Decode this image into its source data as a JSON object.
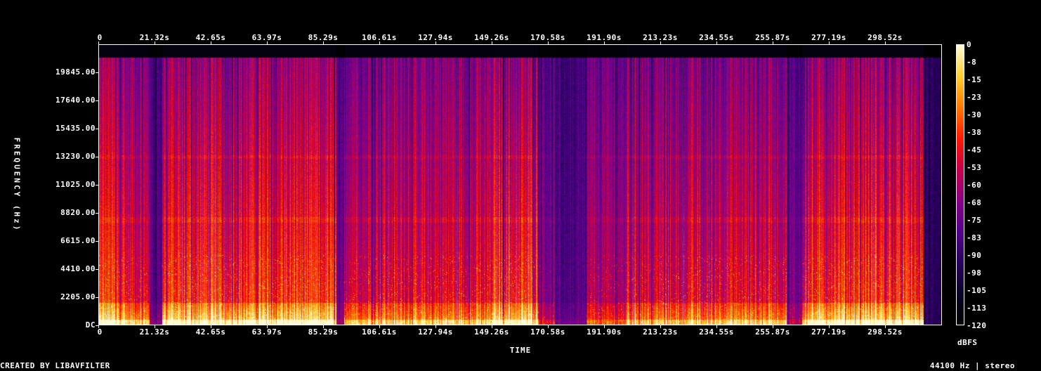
{
  "chart_data": {
    "type": "heatmap",
    "xlabel": "TIME",
    "ylabel": "FREQUENCY (Hz)",
    "x_ticks": [
      "0",
      "21.32s",
      "42.65s",
      "63.97s",
      "85.29s",
      "106.61s",
      "127.94s",
      "149.26s",
      "170.58s",
      "191.90s",
      "213.23s",
      "234.55s",
      "255.87s",
      "277.19s",
      "298.52s"
    ],
    "y_ticks": [
      "DC",
      "2205.00",
      "4410.00",
      "6615.00",
      "8820.00",
      "11025.00",
      "13230.00",
      "15435.00",
      "17640.00",
      "19845.00"
    ],
    "xlim": [
      0,
      319.9
    ],
    "ylim": [
      0,
      22050
    ],
    "colorbar": {
      "label": "dBFS",
      "ticks": [
        "0",
        "-8",
        "-15",
        "-23",
        "-30",
        "-38",
        "-45",
        "-53",
        "-60",
        "-68",
        "-75",
        "-83",
        "-90",
        "-98",
        "-105",
        "-113",
        "-120"
      ],
      "range": [
        -120,
        0
      ],
      "colors": [
        "#000000",
        "#0a0528",
        "#2a0060",
        "#55008f",
        "#8a0085",
        "#c8004a",
        "#ff1a00",
        "#ff7a00",
        "#ffd030",
        "#fffbd8"
      ]
    },
    "segments": [
      {
        "t0": 0,
        "t1": 10,
        "level": 0.9
      },
      {
        "t0": 10,
        "t1": 19,
        "level": 0.75
      },
      {
        "t0": 19,
        "t1": 24,
        "level": 0.25
      },
      {
        "t0": 24,
        "t1": 90,
        "level": 0.9
      },
      {
        "t0": 90,
        "t1": 93,
        "level": 0.25
      },
      {
        "t0": 93,
        "t1": 149,
        "level": 0.75
      },
      {
        "t0": 149,
        "t1": 167,
        "level": 0.9
      },
      {
        "t0": 167,
        "t1": 173,
        "level": 0.45
      },
      {
        "t0": 173,
        "t1": 185,
        "level": 0.2
      },
      {
        "t0": 185,
        "t1": 200,
        "level": 0.55
      },
      {
        "t0": 200,
        "t1": 261,
        "level": 0.75
      },
      {
        "t0": 261,
        "t1": 267,
        "level": 0.35
      },
      {
        "t0": 267,
        "t1": 313,
        "level": 0.9
      },
      {
        "t0": 313,
        "t1": 319.9,
        "level": 0.0
      }
    ]
  },
  "footer": {
    "left": "CREATED BY LIBAVFILTER",
    "right": "44100 Hz | stereo"
  }
}
